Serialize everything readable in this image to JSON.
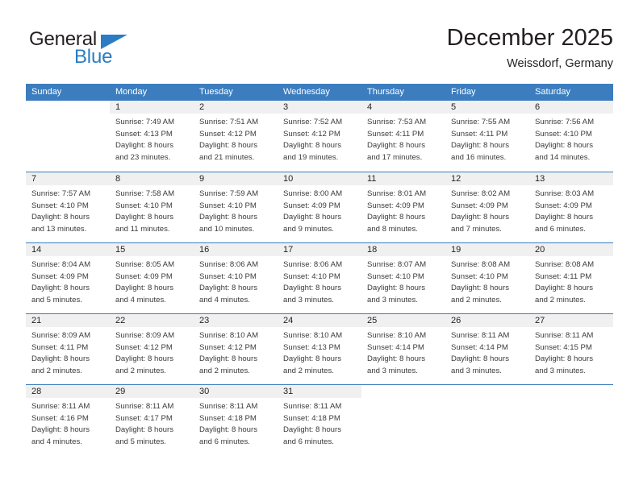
{
  "brand": {
    "name_top": "General",
    "name_bottom": "Blue",
    "accent_color": "#2b7cc4",
    "text_color": "#231f20"
  },
  "header": {
    "title": "December 2025",
    "subtitle": "Weissdorf, Germany"
  },
  "theme": {
    "header_row_bg": "#3b7dbf",
    "header_row_text": "#ffffff",
    "daynum_band_bg": "#f0f0f0",
    "cell_text": "#3b3b3b",
    "grid_line": "#3b7dbf"
  },
  "weekdays": [
    "Sunday",
    "Monday",
    "Tuesday",
    "Wednesday",
    "Thursday",
    "Friday",
    "Saturday"
  ],
  "weeks": [
    [
      {
        "day": "",
        "lines": []
      },
      {
        "day": "1",
        "lines": [
          "Sunrise: 7:49 AM",
          "Sunset: 4:13 PM",
          "Daylight: 8 hours",
          "and 23 minutes."
        ]
      },
      {
        "day": "2",
        "lines": [
          "Sunrise: 7:51 AM",
          "Sunset: 4:12 PM",
          "Daylight: 8 hours",
          "and 21 minutes."
        ]
      },
      {
        "day": "3",
        "lines": [
          "Sunrise: 7:52 AM",
          "Sunset: 4:12 PM",
          "Daylight: 8 hours",
          "and 19 minutes."
        ]
      },
      {
        "day": "4",
        "lines": [
          "Sunrise: 7:53 AM",
          "Sunset: 4:11 PM",
          "Daylight: 8 hours",
          "and 17 minutes."
        ]
      },
      {
        "day": "5",
        "lines": [
          "Sunrise: 7:55 AM",
          "Sunset: 4:11 PM",
          "Daylight: 8 hours",
          "and 16 minutes."
        ]
      },
      {
        "day": "6",
        "lines": [
          "Sunrise: 7:56 AM",
          "Sunset: 4:10 PM",
          "Daylight: 8 hours",
          "and 14 minutes."
        ]
      }
    ],
    [
      {
        "day": "7",
        "lines": [
          "Sunrise: 7:57 AM",
          "Sunset: 4:10 PM",
          "Daylight: 8 hours",
          "and 13 minutes."
        ]
      },
      {
        "day": "8",
        "lines": [
          "Sunrise: 7:58 AM",
          "Sunset: 4:10 PM",
          "Daylight: 8 hours",
          "and 11 minutes."
        ]
      },
      {
        "day": "9",
        "lines": [
          "Sunrise: 7:59 AM",
          "Sunset: 4:10 PM",
          "Daylight: 8 hours",
          "and 10 minutes."
        ]
      },
      {
        "day": "10",
        "lines": [
          "Sunrise: 8:00 AM",
          "Sunset: 4:09 PM",
          "Daylight: 8 hours",
          "and 9 minutes."
        ]
      },
      {
        "day": "11",
        "lines": [
          "Sunrise: 8:01 AM",
          "Sunset: 4:09 PM",
          "Daylight: 8 hours",
          "and 8 minutes."
        ]
      },
      {
        "day": "12",
        "lines": [
          "Sunrise: 8:02 AM",
          "Sunset: 4:09 PM",
          "Daylight: 8 hours",
          "and 7 minutes."
        ]
      },
      {
        "day": "13",
        "lines": [
          "Sunrise: 8:03 AM",
          "Sunset: 4:09 PM",
          "Daylight: 8 hours",
          "and 6 minutes."
        ]
      }
    ],
    [
      {
        "day": "14",
        "lines": [
          "Sunrise: 8:04 AM",
          "Sunset: 4:09 PM",
          "Daylight: 8 hours",
          "and 5 minutes."
        ]
      },
      {
        "day": "15",
        "lines": [
          "Sunrise: 8:05 AM",
          "Sunset: 4:09 PM",
          "Daylight: 8 hours",
          "and 4 minutes."
        ]
      },
      {
        "day": "16",
        "lines": [
          "Sunrise: 8:06 AM",
          "Sunset: 4:10 PM",
          "Daylight: 8 hours",
          "and 4 minutes."
        ]
      },
      {
        "day": "17",
        "lines": [
          "Sunrise: 8:06 AM",
          "Sunset: 4:10 PM",
          "Daylight: 8 hours",
          "and 3 minutes."
        ]
      },
      {
        "day": "18",
        "lines": [
          "Sunrise: 8:07 AM",
          "Sunset: 4:10 PM",
          "Daylight: 8 hours",
          "and 3 minutes."
        ]
      },
      {
        "day": "19",
        "lines": [
          "Sunrise: 8:08 AM",
          "Sunset: 4:10 PM",
          "Daylight: 8 hours",
          "and 2 minutes."
        ]
      },
      {
        "day": "20",
        "lines": [
          "Sunrise: 8:08 AM",
          "Sunset: 4:11 PM",
          "Daylight: 8 hours",
          "and 2 minutes."
        ]
      }
    ],
    [
      {
        "day": "21",
        "lines": [
          "Sunrise: 8:09 AM",
          "Sunset: 4:11 PM",
          "Daylight: 8 hours",
          "and 2 minutes."
        ]
      },
      {
        "day": "22",
        "lines": [
          "Sunrise: 8:09 AM",
          "Sunset: 4:12 PM",
          "Daylight: 8 hours",
          "and 2 minutes."
        ]
      },
      {
        "day": "23",
        "lines": [
          "Sunrise: 8:10 AM",
          "Sunset: 4:12 PM",
          "Daylight: 8 hours",
          "and 2 minutes."
        ]
      },
      {
        "day": "24",
        "lines": [
          "Sunrise: 8:10 AM",
          "Sunset: 4:13 PM",
          "Daylight: 8 hours",
          "and 2 minutes."
        ]
      },
      {
        "day": "25",
        "lines": [
          "Sunrise: 8:10 AM",
          "Sunset: 4:14 PM",
          "Daylight: 8 hours",
          "and 3 minutes."
        ]
      },
      {
        "day": "26",
        "lines": [
          "Sunrise: 8:11 AM",
          "Sunset: 4:14 PM",
          "Daylight: 8 hours",
          "and 3 minutes."
        ]
      },
      {
        "day": "27",
        "lines": [
          "Sunrise: 8:11 AM",
          "Sunset: 4:15 PM",
          "Daylight: 8 hours",
          "and 3 minutes."
        ]
      }
    ],
    [
      {
        "day": "28",
        "lines": [
          "Sunrise: 8:11 AM",
          "Sunset: 4:16 PM",
          "Daylight: 8 hours",
          "and 4 minutes."
        ]
      },
      {
        "day": "29",
        "lines": [
          "Sunrise: 8:11 AM",
          "Sunset: 4:17 PM",
          "Daylight: 8 hours",
          "and 5 minutes."
        ]
      },
      {
        "day": "30",
        "lines": [
          "Sunrise: 8:11 AM",
          "Sunset: 4:18 PM",
          "Daylight: 8 hours",
          "and 6 minutes."
        ]
      },
      {
        "day": "31",
        "lines": [
          "Sunrise: 8:11 AM",
          "Sunset: 4:18 PM",
          "Daylight: 8 hours",
          "and 6 minutes."
        ]
      },
      {
        "day": "",
        "lines": []
      },
      {
        "day": "",
        "lines": []
      },
      {
        "day": "",
        "lines": []
      }
    ]
  ]
}
